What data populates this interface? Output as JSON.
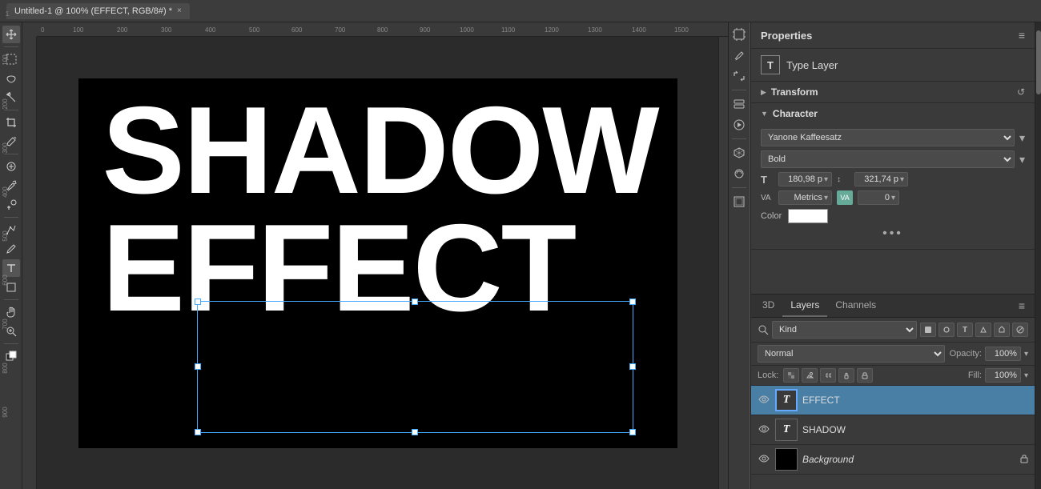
{
  "topbar": {
    "tab_title": "Untitled-1 @ 100% (EFFECT, RGB/8#) *",
    "close": "×"
  },
  "properties": {
    "title": "Properties",
    "menu_icon": "≡",
    "type_layer_label": "Type Layer",
    "type_icon": "T",
    "transform_label": "Transform",
    "refresh_icon": "↺",
    "character_label": "Character",
    "font_family": "Yanone Kaffeesatz",
    "font_style": "Bold",
    "font_size": "180,98 p",
    "leading": "321,74 p",
    "tracking_label": "Metrics",
    "kerning_value": "0",
    "color_label": "Color",
    "more_icon": "•••"
  },
  "layers": {
    "tab_3d": "3D",
    "tab_layers": "Layers",
    "tab_channels": "Channels",
    "menu_icon": "≡",
    "kind_label": "Kind",
    "blend_mode": "Normal",
    "opacity_label": "Opacity:",
    "opacity_value": "100%",
    "lock_label": "Lock:",
    "fill_label": "Fill:",
    "fill_value": "100%",
    "items": [
      {
        "name": "EFFECT",
        "type": "text",
        "active": true,
        "italic": false
      },
      {
        "name": "SHADOW",
        "type": "text",
        "active": false,
        "italic": false
      },
      {
        "name": "Background",
        "type": "image",
        "active": false,
        "italic": true
      }
    ]
  },
  "canvas": {
    "line1": "SHADOW",
    "line2": "EFFECT",
    "zoom": "100%"
  },
  "tools": {
    "items": [
      "✥",
      "⬡",
      "✂",
      "⬜",
      "⬤",
      "✒",
      "⌫",
      "☁",
      "✏",
      "➚",
      "T",
      "⬛",
      "💧",
      "🔍"
    ]
  }
}
